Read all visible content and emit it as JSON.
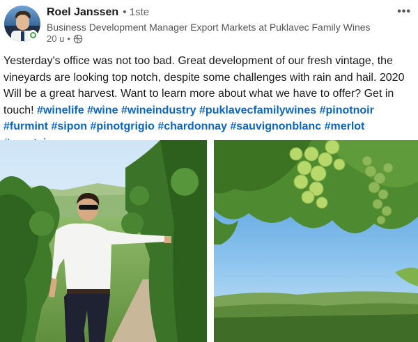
{
  "author": {
    "name": "Roel Janssen",
    "separator": "•",
    "degree": "1ste",
    "headline": "Business Development Manager Export Markets at Puklavec Family Wines",
    "time": "20 u",
    "meta_separator": "•",
    "visibility_icon": "globe-icon"
  },
  "menu_icon": "more-options-icon",
  "post": {
    "text": "Yesterday's office was not too bad. Great development of our fresh vintage, the vineyards are looking top notch, despite some challenges with rain and hail. 2020 Will be a great harvest. Want to learn more about what we have to offer? Get in touch!",
    "hashtags": [
      "#winelife",
      "#wine",
      "#wineindustry",
      "#puklavecfamilywines",
      "#pinotnoir",
      "#furmint",
      "#sipon",
      "#pinotgrigio",
      "#chardonnay",
      "#sauvignonblanc",
      "#merlot",
      "#greatviews"
    ]
  },
  "colors": {
    "hashtag": "#0a66c2",
    "online": "#4aa34b"
  }
}
